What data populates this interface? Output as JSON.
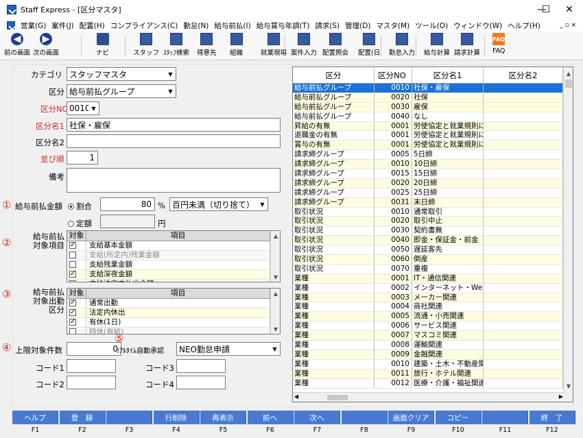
{
  "window": {
    "title": "Staff Express - [区分マスタ]",
    "minimize": "—",
    "maximize": "☐",
    "close": "✕"
  },
  "menu": [
    "営業(G)",
    "案件(J)",
    "配置(H)",
    "コンプライアンス(C)",
    "勤怠(N)",
    "給与前払(I)",
    "給与賞与年調(T)",
    "請求(S)",
    "管理(D)",
    "マスタ(M)",
    "ツール(O)",
    "ウィンドウ(W)",
    "ヘルプ(H)"
  ],
  "toolbar": [
    {
      "label": "前の画面",
      "icon": "arrow-left-icon"
    },
    {
      "label": "次の画面",
      "icon": "arrow-right-icon"
    },
    {
      "label": "ナビ",
      "icon": "navi-icon"
    },
    {
      "label": "スタッフ",
      "icon": "staff-icon"
    },
    {
      "label": "ｽﾀｯﾌ検索",
      "icon": "staff-search-icon"
    },
    {
      "label": "得意先",
      "icon": "customer-icon"
    },
    {
      "label": "組織",
      "icon": "organization-icon"
    },
    {
      "label": "就業現場",
      "icon": "workplace-icon"
    },
    {
      "label": "案件入力",
      "icon": "case-entry-icon"
    },
    {
      "label": "配置照会",
      "icon": "placement-inquiry-icon"
    },
    {
      "label": "配置(日",
      "icon": "placement-day-icon"
    },
    {
      "label": "勤怠入力",
      "icon": "attendance-entry-icon"
    },
    {
      "label": "給与計算",
      "icon": "payroll-icon"
    },
    {
      "label": "請求計算",
      "icon": "billing-icon"
    },
    {
      "label": "FAQ",
      "icon": "faq-icon"
    }
  ],
  "form": {
    "category_label": "カテゴリ",
    "category_value": "スタッフマスタ",
    "kubun_label": "区分",
    "kubun_value": "給与前払グループ",
    "kubun_no_label": "区分NO",
    "kubun_no_value": "0010",
    "kubun_name1_label": "区分名1",
    "kubun_name1_value": "社保・雇保",
    "kubun_name2_label": "区分名2",
    "kubun_name2_value": "",
    "order_label": "並び順",
    "order_value": "1",
    "remarks_label": "備考",
    "remarks_value": "",
    "advance_label": "給与前払金額",
    "ratio_label": "割合",
    "ratio_value": "80",
    "percent": "%",
    "rounding_value": "百円未満（切り捨て）",
    "fixed_label": "定額",
    "fixed_value": "",
    "yen": "円",
    "items_label1": "給与前払",
    "items_label2": "対象項目",
    "att_label1": "給与前払",
    "att_label2": "対象出勤",
    "att_label3": "区分",
    "limit_label": "上限対象件数",
    "limit_value": "0",
    "realtime_label": "ﾘｱﾙﾀｲﾑ自動承認",
    "realtime_value": "NEO勤怠申請",
    "code1_label": "コード1",
    "code2_label": "コード2",
    "code3_label": "コード3",
    "code4_label": "コード4",
    "code1": "",
    "code2": "",
    "code3": "",
    "code4": ""
  },
  "markers": [
    "①",
    "②",
    "③",
    "④",
    "⑤"
  ],
  "items_grid": {
    "headers": [
      "対象",
      "項目"
    ],
    "rows": [
      {
        "checked": true,
        "name": "支給基本金額",
        "style": "w"
      },
      {
        "checked": false,
        "name": "支給(所定内)残業金額",
        "style": "g"
      },
      {
        "checked": false,
        "name": "支給残業金額",
        "style": "w"
      },
      {
        "checked": true,
        "name": "支給深夜金額",
        "style": "y"
      },
      {
        "checked": false,
        "name": "支給法定内休出金額",
        "style": "w"
      }
    ]
  },
  "att_grid": {
    "headers": [
      "対象",
      "項目"
    ],
    "rows": [
      {
        "checked": true,
        "name": "通常出勤",
        "style": "w"
      },
      {
        "checked": true,
        "name": "法定内休出",
        "style": "y"
      },
      {
        "checked": true,
        "name": "有休(1日)",
        "style": "w"
      },
      {
        "checked": false,
        "name": "特休(有給)",
        "style": "g"
      }
    ]
  },
  "list": {
    "headers": [
      "区分",
      "区分NO",
      "区分名1",
      "区分名2"
    ],
    "rows": [
      [
        "給与前払グループ",
        "0010",
        "社保・雇保",
        "",
        "sel"
      ],
      [
        "給与前払グループ",
        "0020",
        "社保",
        "",
        "y"
      ],
      [
        "給与前払グループ",
        "0030",
        "雇保",
        "",
        "y"
      ],
      [
        "給与前払グループ",
        "0040",
        "なし",
        "",
        "w"
      ],
      [
        "昇給の有無",
        "0001",
        "労使協定と就業規則に",
        "",
        "y"
      ],
      [
        "退職金の有無",
        "0001",
        "労使協定と就業規則に",
        "",
        "w"
      ],
      [
        "賞与の有無",
        "0001",
        "労使協定と就業規則に",
        "",
        "y"
      ],
      [
        "請求締グループ",
        "0005",
        "5日締",
        "",
        "w"
      ],
      [
        "請求締グループ",
        "0010",
        "10日締",
        "",
        "y"
      ],
      [
        "請求締グループ",
        "0015",
        "15日締",
        "",
        "w"
      ],
      [
        "請求締グループ",
        "0020",
        "20日締",
        "",
        "y"
      ],
      [
        "請求締グループ",
        "0025",
        "25日締",
        "",
        "w"
      ],
      [
        "請求締グループ",
        "0031",
        "末日締",
        "",
        "y"
      ],
      [
        "取引状況",
        "0010",
        "通常取引",
        "",
        "w"
      ],
      [
        "取引状況",
        "0020",
        "取引中止",
        "",
        "y"
      ],
      [
        "取引状況",
        "0030",
        "契約書無",
        "",
        "w"
      ],
      [
        "取引状況",
        "0040",
        "即金・保証金・前金",
        "",
        "y"
      ],
      [
        "取引状況",
        "0050",
        "遅延客先",
        "",
        "w"
      ],
      [
        "取引状況",
        "0060",
        "倒産",
        "",
        "y"
      ],
      [
        "取引状況",
        "0070",
        "重複",
        "",
        "w"
      ],
      [
        "業種",
        "0001",
        "IT・通信関連",
        "",
        "y"
      ],
      [
        "業種",
        "0002",
        "インターネット・Webｻ",
        "",
        "w"
      ],
      [
        "業種",
        "0003",
        "メーカー関連",
        "",
        "y"
      ],
      [
        "業種",
        "0004",
        "商社関連",
        "",
        "w"
      ],
      [
        "業種",
        "0005",
        "流通・小売関連",
        "",
        "y"
      ],
      [
        "業種",
        "0006",
        "サービス関連",
        "",
        "w"
      ],
      [
        "業種",
        "0007",
        "マスコミ関連",
        "",
        "y"
      ],
      [
        "業種",
        "0008",
        "運輸関連",
        "",
        "w"
      ],
      [
        "業種",
        "0009",
        "金融関連",
        "",
        "y"
      ],
      [
        "業種",
        "0010",
        "建築・土木・不動産関",
        "",
        "w"
      ],
      [
        "業種",
        "0011",
        "旅行・ホテル関連",
        "",
        "y"
      ],
      [
        "業種",
        "0012",
        "医療・介護・福祉関連",
        "",
        "w"
      ]
    ]
  },
  "fkeys": [
    {
      "label": "ヘルプ",
      "key": "F1"
    },
    {
      "label": "登　録",
      "key": "F2"
    },
    {
      "label": "",
      "key": "F3"
    },
    {
      "label": "行削除",
      "key": "F4"
    },
    {
      "label": "再表示",
      "key": "F5"
    },
    {
      "label": "前へ",
      "key": "F6"
    },
    {
      "label": "次へ",
      "key": "F7"
    },
    {
      "label": "",
      "key": "F8"
    },
    {
      "label": "画面クリア",
      "key": "F9"
    },
    {
      "label": "コピー",
      "key": "F10"
    },
    {
      "label": "",
      "key": "F11"
    },
    {
      "label": "終　了",
      "key": "F12"
    }
  ]
}
